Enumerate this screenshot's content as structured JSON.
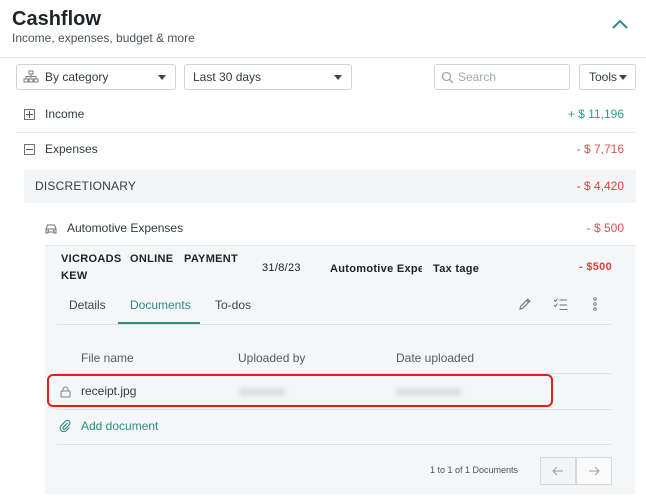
{
  "header": {
    "title": "Cashflow",
    "subtitle": "Income, expenses, budget & more"
  },
  "toolbar": {
    "group_by": "By category",
    "period": "Last 30 days",
    "search_placeholder": "Search",
    "tools_label": "Tools"
  },
  "summary": {
    "income": {
      "label": "Income",
      "amount": "+ $ 11,196"
    },
    "expenses": {
      "label": "Expenses",
      "amount": "- $ 7,716"
    },
    "discretionary": {
      "label": "DISCRETIONARY",
      "amount": "- $ 4,420"
    },
    "automotive": {
      "label": "Automotive Expenses",
      "amount": "- $ 500"
    }
  },
  "transaction": {
    "desc_line1_a": "VICROADS",
    "desc_line1_b": "ONLINE",
    "desc_line1_c": "PAYMENT",
    "desc_line2": "KEW",
    "date": "31/8/23",
    "category": "Automotive Exper",
    "tag": "Tax tage",
    "amount": "- $500"
  },
  "detail_tabs": {
    "details": "Details",
    "documents": "Documents",
    "todos": "To-dos"
  },
  "documents": {
    "columns": [
      "File name",
      "Uploaded by",
      "Date uploaded"
    ],
    "rows": [
      {
        "file_name": "receipt.jpg"
      }
    ],
    "add_label": "Add document",
    "pagination": "1 to 1 of 1 Documents"
  },
  "colors": {
    "accent": "#2e8b84",
    "negative": "#d9534f",
    "highlight": "#e0201b"
  }
}
